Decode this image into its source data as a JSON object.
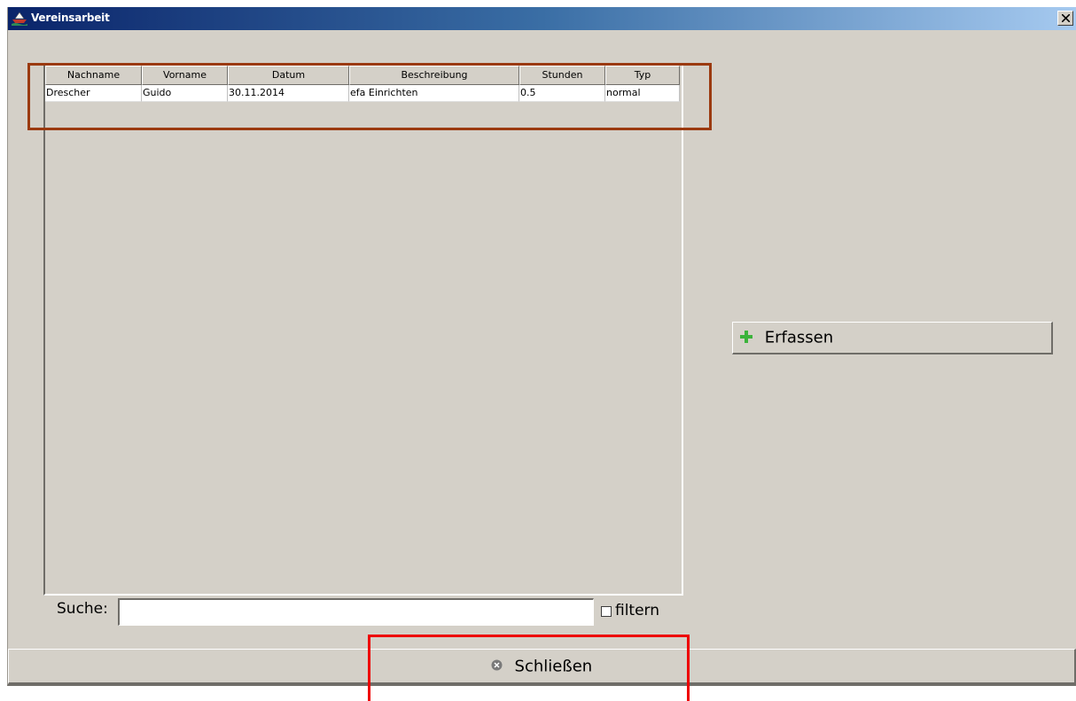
{
  "window": {
    "title": "Vereinsarbeit",
    "close_icon": "close-x-icon"
  },
  "table": {
    "columns": [
      {
        "label": "Nachname"
      },
      {
        "label": "Vorname"
      },
      {
        "label": "Datum"
      },
      {
        "label": "Beschreibung"
      },
      {
        "label": "Stunden"
      },
      {
        "label": "Typ"
      }
    ],
    "rows": [
      [
        "Drescher",
        "Guido",
        "30.11.2014",
        "efa Einrichten",
        "0.5",
        "normal"
      ]
    ]
  },
  "search": {
    "label": "Suche:",
    "value": "",
    "filter_label": "filtern",
    "filter_checked": false
  },
  "buttons": {
    "erfassen_label": "Erfassen",
    "erfassen_icon": "plus-icon",
    "schliessen_label": "Schließen",
    "schliessen_icon": "close-circle-icon"
  },
  "colors": {
    "annotation_table": "#9b3a10",
    "annotation_close": "#ee0000",
    "plus_green": "#3bb33b"
  }
}
